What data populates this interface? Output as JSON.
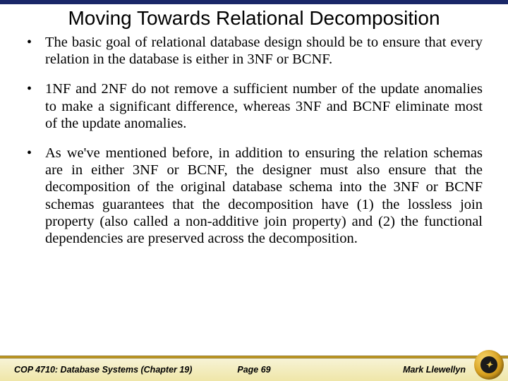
{
  "title": "Moving Towards Relational Decomposition",
  "bullets": [
    "The basic goal of relational database design should be to ensure that every relation in the database is either in 3NF or BCNF.",
    "1NF and 2NF do not remove a sufficient number of the update anomalies to make a significant difference, whereas 3NF and BCNF eliminate most of the update anomalies.",
    "As we've mentioned before, in addition to ensuring the relation schemas are in either 3NF or BCNF, the designer must also ensure that the decomposition of the original database schema into the 3NF or BCNF schemas guarantees that the decomposition have (1) the lossless join property (also called a non-additive join property) and (2) the functional dependencies are preserved across the decomposition."
  ],
  "footer": {
    "left": "COP 4710: Database Systems  (Chapter 19)",
    "center": "Page 69",
    "right": "Mark Llewellyn"
  }
}
